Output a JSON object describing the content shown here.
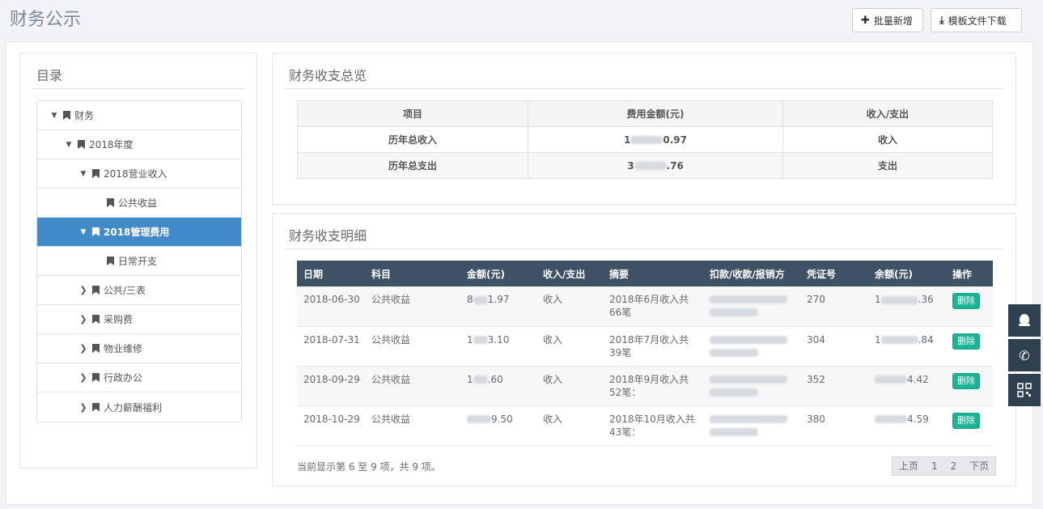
{
  "page": {
    "title": "财务公示"
  },
  "toolbar": {
    "batch_add_label": "批量新增",
    "template_download_label": "模板文件下载"
  },
  "catalog": {
    "title": "目录",
    "nodes": [
      {
        "label": "财务",
        "level": 0,
        "expanded": true
      },
      {
        "label": "2018年度",
        "level": 1,
        "expanded": true
      },
      {
        "label": "2018营业收入",
        "level": 2,
        "expanded": true
      },
      {
        "label": "公共收益",
        "level": 3,
        "expanded": null
      },
      {
        "label": "2018管理费用",
        "level": 2,
        "expanded": true,
        "active": true
      },
      {
        "label": "日常开支",
        "level": 3,
        "expanded": null
      },
      {
        "label": "公共/三表",
        "level": 2,
        "expanded": false
      },
      {
        "label": "采购费",
        "level": 2,
        "expanded": false
      },
      {
        "label": "物业维修",
        "level": 2,
        "expanded": false
      },
      {
        "label": "行政办公",
        "level": 2,
        "expanded": false
      },
      {
        "label": "人力薪酬福利",
        "level": 2,
        "expanded": false
      }
    ]
  },
  "summary": {
    "title": "财务收支总览",
    "headers": [
      "项目",
      "费用金额(元)",
      "收入/支出"
    ],
    "rows": [
      {
        "item": "历年总收入",
        "amount_prefix": "1",
        "amount_suffix": "0.97",
        "type": "收入"
      },
      {
        "item": "历年总支出",
        "amount_prefix": "3",
        "amount_suffix": ".76",
        "type": "支出"
      }
    ]
  },
  "detail": {
    "title": "财务收支明细",
    "headers": [
      "日期",
      "科目",
      "金额(元)",
      "收入/支出",
      "摘要",
      "扣款/收款/报销方",
      "凭证号",
      "余额(元)",
      "操作"
    ],
    "rows": [
      {
        "date": "2018-06-30",
        "subject": "公共收益",
        "amount_prefix": "8",
        "amount_suffix": "1.97",
        "type": "收入",
        "summary": "2018年6月收入共66笔",
        "voucher": "270",
        "balance_prefix": "1",
        "balance_suffix": ".36",
        "action": "删除"
      },
      {
        "date": "2018-07-31",
        "subject": "公共收益",
        "amount_prefix": "1",
        "amount_suffix": "3.10",
        "type": "收入",
        "summary": "2018年7月收入共39笔",
        "voucher": "304",
        "balance_prefix": "1",
        "balance_suffix": ".84",
        "action": "删除"
      },
      {
        "date": "2018-09-29",
        "subject": "公共收益",
        "amount_prefix": "1",
        "amount_suffix": ".60",
        "type": "收入",
        "summary": "2018年9月收入共52笔：",
        "voucher": "352",
        "balance_prefix": "",
        "balance_suffix": "4.42",
        "action": "删除"
      },
      {
        "date": "2018-10-29",
        "subject": "公共收益",
        "amount_prefix": "",
        "amount_suffix": "9.50",
        "type": "收入",
        "summary": "2018年10月收入共43笔：",
        "voucher": "380",
        "balance_prefix": "",
        "balance_suffix": "4.59",
        "action": "删除"
      }
    ],
    "pager_info": "当前显示第 6 至 9 项，共 9 项。",
    "pager": {
      "prev": "上页",
      "pages": [
        "1",
        "2"
      ],
      "next": "下页"
    }
  },
  "float_buttons": [
    "qq-icon",
    "phone-icon",
    "qrcode-icon"
  ]
}
